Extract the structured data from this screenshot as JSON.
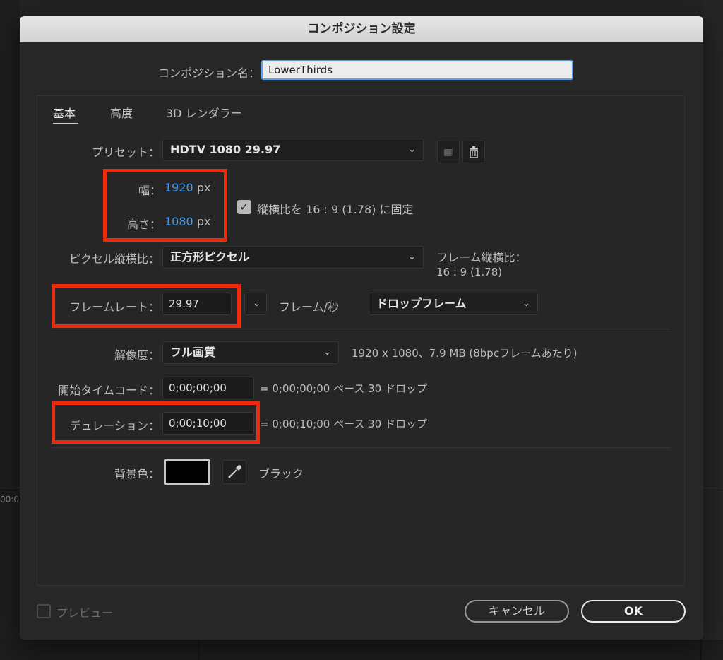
{
  "background": {
    "left_text": "00:0"
  },
  "dialog": {
    "title": "コンポジション設定",
    "name_label": "コンポジション名：",
    "name_value": "LowerThirds",
    "tabs": [
      "基本",
      "高度",
      "3D レンダラー"
    ],
    "preset": {
      "label": "プリセット：",
      "value": "HDTV 1080 29.97"
    },
    "width": {
      "label": "幅：",
      "value": "1920",
      "unit": "px"
    },
    "height": {
      "label": "高さ：",
      "value": "1080",
      "unit": "px"
    },
    "aspect_lock": {
      "checked": true,
      "label": "縦横比を 16 : 9 (1.78) に固定"
    },
    "pixel_aspect": {
      "label": "ピクセル縦横比：",
      "value": "正方形ピクセル"
    },
    "frame_aspect": {
      "label": "フレーム縦横比：",
      "value": "16 : 9 (1.78)"
    },
    "frame_rate": {
      "label": "フレームレート：",
      "value": "29.97",
      "unit": "フレーム/秒",
      "mode": "ドロップフレーム"
    },
    "resolution": {
      "label": "解像度：",
      "value": "フル画質",
      "info": "1920 x 1080、7.9 MB (8bpcフレームあたり)"
    },
    "start_timecode": {
      "label": "開始タイムコード：",
      "value": "0;00;00;00",
      "info": "= 0;00;00;00  ベース 30  ドロップ"
    },
    "duration": {
      "label": "デュレーション：",
      "value": "0;00;10;00",
      "info": "= 0;00;10;00  ベース 30  ドロップ"
    },
    "bg_color": {
      "label": "背景色：",
      "name": "ブラック",
      "swatch": "#000000"
    },
    "preview_label": "プレビュー",
    "cancel_label": "キャンセル",
    "ok_label": "OK"
  },
  "colors": {
    "highlight": "#f0290a",
    "value_blue": "#3d9bf0",
    "focus": "#5aa0f0"
  },
  "icons": [
    "new-preset-icon",
    "trash-icon",
    "chevron-down-icon",
    "checkmark-icon",
    "eyedropper-icon"
  ]
}
